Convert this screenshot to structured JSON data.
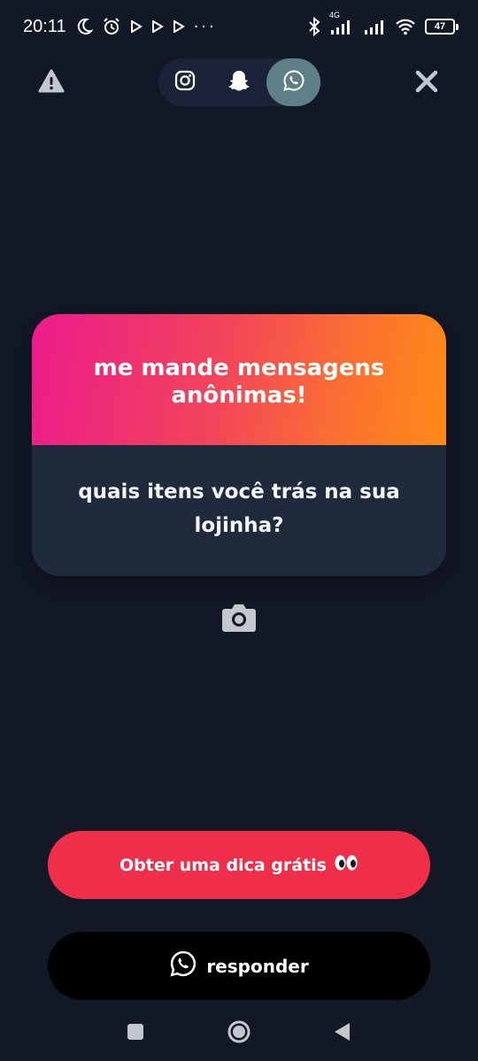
{
  "status_bar": {
    "time": "20:11",
    "network": "4G",
    "battery": "47",
    "more": "···"
  },
  "top_bar": {
    "report_icon": "warning-triangle-icon",
    "share_targets": [
      {
        "name": "instagram",
        "icon": "instagram-icon"
      },
      {
        "name": "snapchat",
        "icon": "snapchat-ghost-icon"
      },
      {
        "name": "whatsapp",
        "icon": "whatsapp-icon",
        "selected": true
      }
    ],
    "close_icon": "close-icon"
  },
  "card": {
    "title": "me mande mensagens anônimas!",
    "question": "quais itens você trás na sua lojinha?"
  },
  "camera_icon": "camera-icon",
  "buttons": {
    "tip_label": "Obter uma dica grátis",
    "tip_emoji": "👀",
    "reply_label": "responder",
    "reply_icon": "whatsapp-icon"
  },
  "colors": {
    "background": "#131826",
    "card_body": "#1f2a3d",
    "gradient_start": "#ec1b8c",
    "gradient_end": "#ff8b16",
    "tip_button": "#ef2f4a",
    "reply_button": "#000000",
    "whatsapp_selected": "#5f7f87"
  }
}
